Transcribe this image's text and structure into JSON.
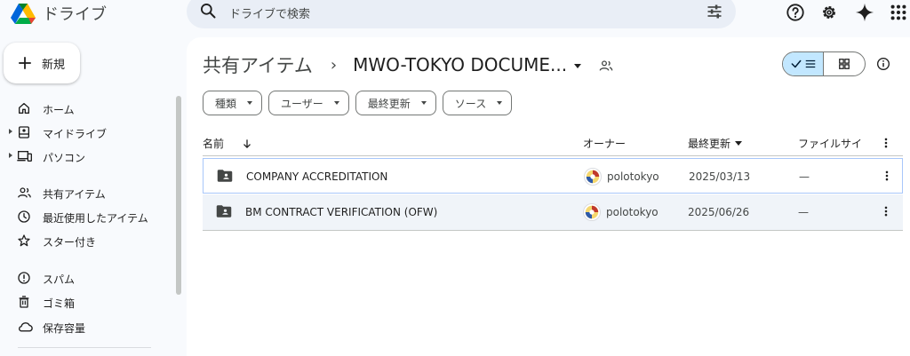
{
  "app": {
    "title": "ドライブ"
  },
  "search": {
    "placeholder": "ドライブで検索"
  },
  "new_button": {
    "label": "新規"
  },
  "sidebar": {
    "items": [
      {
        "label": "ホーム",
        "icon": "home-icon"
      },
      {
        "label": "マイドライブ",
        "icon": "my-drive-icon"
      },
      {
        "label": "パソコン",
        "icon": "computer-icon"
      },
      {
        "label": "共有アイテム",
        "icon": "shared-icon"
      },
      {
        "label": "最近使用したアイテム",
        "icon": "recent-icon"
      },
      {
        "label": "スター付き",
        "icon": "star-icon"
      },
      {
        "label": "スパム",
        "icon": "spam-icon"
      },
      {
        "label": "ゴミ箱",
        "icon": "trash-icon"
      },
      {
        "label": "保存容量",
        "icon": "cloud-icon"
      }
    ]
  },
  "breadcrumb": {
    "root": "共有アイテム",
    "separator": "›",
    "current": "MWO-TOKYO DOCUME..."
  },
  "filters": [
    {
      "label": "種類"
    },
    {
      "label": "ユーザー"
    },
    {
      "label": "最終更新"
    },
    {
      "label": "ソース"
    }
  ],
  "table": {
    "columns": {
      "name": "名前",
      "owner": "オーナー",
      "modified": "最終更新",
      "size": "ファイルサイ"
    },
    "rows": [
      {
        "name": "COMPANY ACCREDITATION",
        "owner": "polotokyo",
        "modified": "2025/03/13",
        "size": "—"
      },
      {
        "name": "BM CONTRACT VERIFICATION (OFW)",
        "owner": "polotokyo",
        "modified": "2025/06/26",
        "size": "—"
      }
    ]
  },
  "colors": {
    "accent": "#c2e7ff",
    "selected_border": "#a8c7fa",
    "search_bg": "#e9eef6",
    "page_bg": "#f8fafd"
  }
}
